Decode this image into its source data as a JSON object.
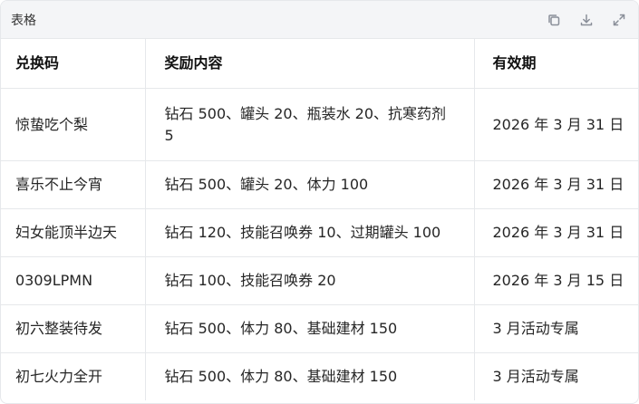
{
  "header": {
    "title": "表格",
    "icons": [
      "copy-icon",
      "download-icon",
      "expand-icon"
    ]
  },
  "table": {
    "columns": [
      "兑换码",
      "奖励内容",
      "有效期"
    ],
    "rows": [
      {
        "code": "惊蛰吃个梨",
        "reward": "钻石 500、罐头 20、瓶装水 20、抗寒药剂 5",
        "valid": "2026 年 3 月 31 日"
      },
      {
        "code": "喜乐不止今宵",
        "reward": "钻石 500、罐头 20、体力 100",
        "valid": "2026 年 3 月 31 日"
      },
      {
        "code": "妇女能顶半边天",
        "reward": "钻石 120、技能召唤券 10、过期罐头 100",
        "valid": "2026 年 3 月 31 日"
      },
      {
        "code": "0309LPMN",
        "reward": "钻石 100、技能召唤券 20",
        "valid": "2026 年 3 月 15 日"
      },
      {
        "code": "初六整装待发",
        "reward": "钻石 500、体力 80、基础建材 150",
        "valid": "3 月活动专属"
      },
      {
        "code": "初七火力全开",
        "reward": "钻石 500、体力 80、基础建材 150",
        "valid": "3 月活动专属"
      }
    ]
  }
}
